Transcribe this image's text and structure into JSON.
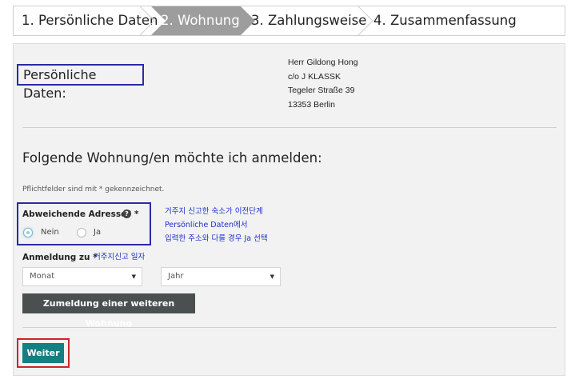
{
  "steps": [
    {
      "label": "1. Persönliche Daten"
    },
    {
      "label": "2. Wohnung"
    },
    {
      "label": "3. Zahlungsweise"
    },
    {
      "label": "4. Zusammenfassung"
    }
  ],
  "personal": {
    "title": "Persönliche Daten:",
    "address_lines": [
      "Herr Gildong Hong",
      "c/o J KLASSK",
      "Tegeler Straße 39",
      "13353 Berlin"
    ]
  },
  "apartment": {
    "heading": "Folgende Wohnung/en möchte ich anmelden:",
    "required_note": "Pflichtfelder sind mit * gekennzeichnet.",
    "diff_address_label": "Abweichende Adresse? *",
    "help_icon": "?",
    "options": {
      "no": "Nein",
      "yes": "Ja",
      "selected": "no"
    },
    "annotation_lines": [
      "거주지 신고한 숙소가 이전단계",
      "Persönliche Daten에서",
      "입력한 주소와 다를 경우 Ja 선택"
    ],
    "registration_label": "Anmeldung zu *",
    "registration_annotation": "거주지신고 일자",
    "month_placeholder": "Monat",
    "year_placeholder": "Jahr",
    "add_button": "Zumeldung einer weiteren Wohnung"
  },
  "footer": {
    "next_button": "Weiter"
  },
  "colors": {
    "active_step": "#9d9d9d",
    "next_button": "#137f82",
    "add_button": "#4a4f4f",
    "highlight_blue": "#2a2aa8",
    "highlight_red": "#c9252b",
    "annotation": "#1a2fd0"
  }
}
